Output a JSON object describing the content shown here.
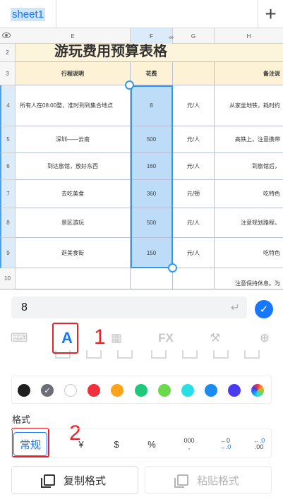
{
  "sheet_tab": {
    "label": "sheet1"
  },
  "add_sheet_icon": "+",
  "columns": {
    "E": "E",
    "F": "F",
    "G": "G",
    "H": "H"
  },
  "rows": {
    "r2": "2",
    "r3": "3",
    "r4": "4",
    "r5": "5",
    "r6": "6",
    "r7": "7",
    "r8": "8",
    "r9": "9",
    "r10": "10"
  },
  "table": {
    "title": "游玩费用预算表格",
    "header": {
      "desc": "行程说明",
      "cost": "花费",
      "unit": "",
      "note": "备注说"
    },
    "data_rows": [
      {
        "desc": "所有人在08:00整，准时到到集合地点",
        "cost": "8",
        "unit": "元/人",
        "note": "从家坐地铁，耗时约"
      },
      {
        "desc": "深圳——云南",
        "cost": "500",
        "unit": "元/人",
        "note": "高铁上，注意携带"
      },
      {
        "desc": "到达旅馆，放好东西",
        "cost": "160",
        "unit": "元/人",
        "note": "到旅馆后，"
      },
      {
        "desc": "去吃美食",
        "cost": "360",
        "unit": "元/顿",
        "note": "吃特色"
      },
      {
        "desc": "景区游玩",
        "cost": "500",
        "unit": "元/人",
        "note": "注意规划路程，"
      },
      {
        "desc": "逛美食街",
        "cost": "150",
        "unit": "元/人",
        "note": "吃特色"
      }
    ],
    "row10_note": "注意保持休息。为"
  },
  "input": {
    "value": "8",
    "enter_icon": "↵",
    "confirm_icon": "✓"
  },
  "toolbar": {
    "keyboard_icon": "⌨",
    "font_label": "A",
    "cell_icon": "▦",
    "fx_label": "FX",
    "tools_icon": "⚒",
    "more_icon": "⊕"
  },
  "annotations": {
    "one": "1",
    "two": "2"
  },
  "colors": [
    "#1f1f1f",
    "#6b6e78",
    "#ffffff",
    "#f0303a",
    "#ffa31a",
    "#1ec97a",
    "#6ad94a",
    "#26e0e6",
    "#1a8cf0",
    "#4a3af0",
    "#e8e8e8"
  ],
  "format": {
    "label": "格式",
    "general": "常规",
    "yen": "¥",
    "dollar": "$",
    "percent": "%",
    "thousands_top": "000",
    "thousands_bottom": ",",
    "dec_add_top": "←0",
    "dec_add_bottom": "→.0",
    "dec_remove_top": "←.0",
    "dec_remove_bottom": ".00"
  },
  "buttons": {
    "copy_format": "复制格式",
    "paste_format": "粘贴格式"
  },
  "accent_color": "#1677ff",
  "annotation_color": "#e3242b"
}
